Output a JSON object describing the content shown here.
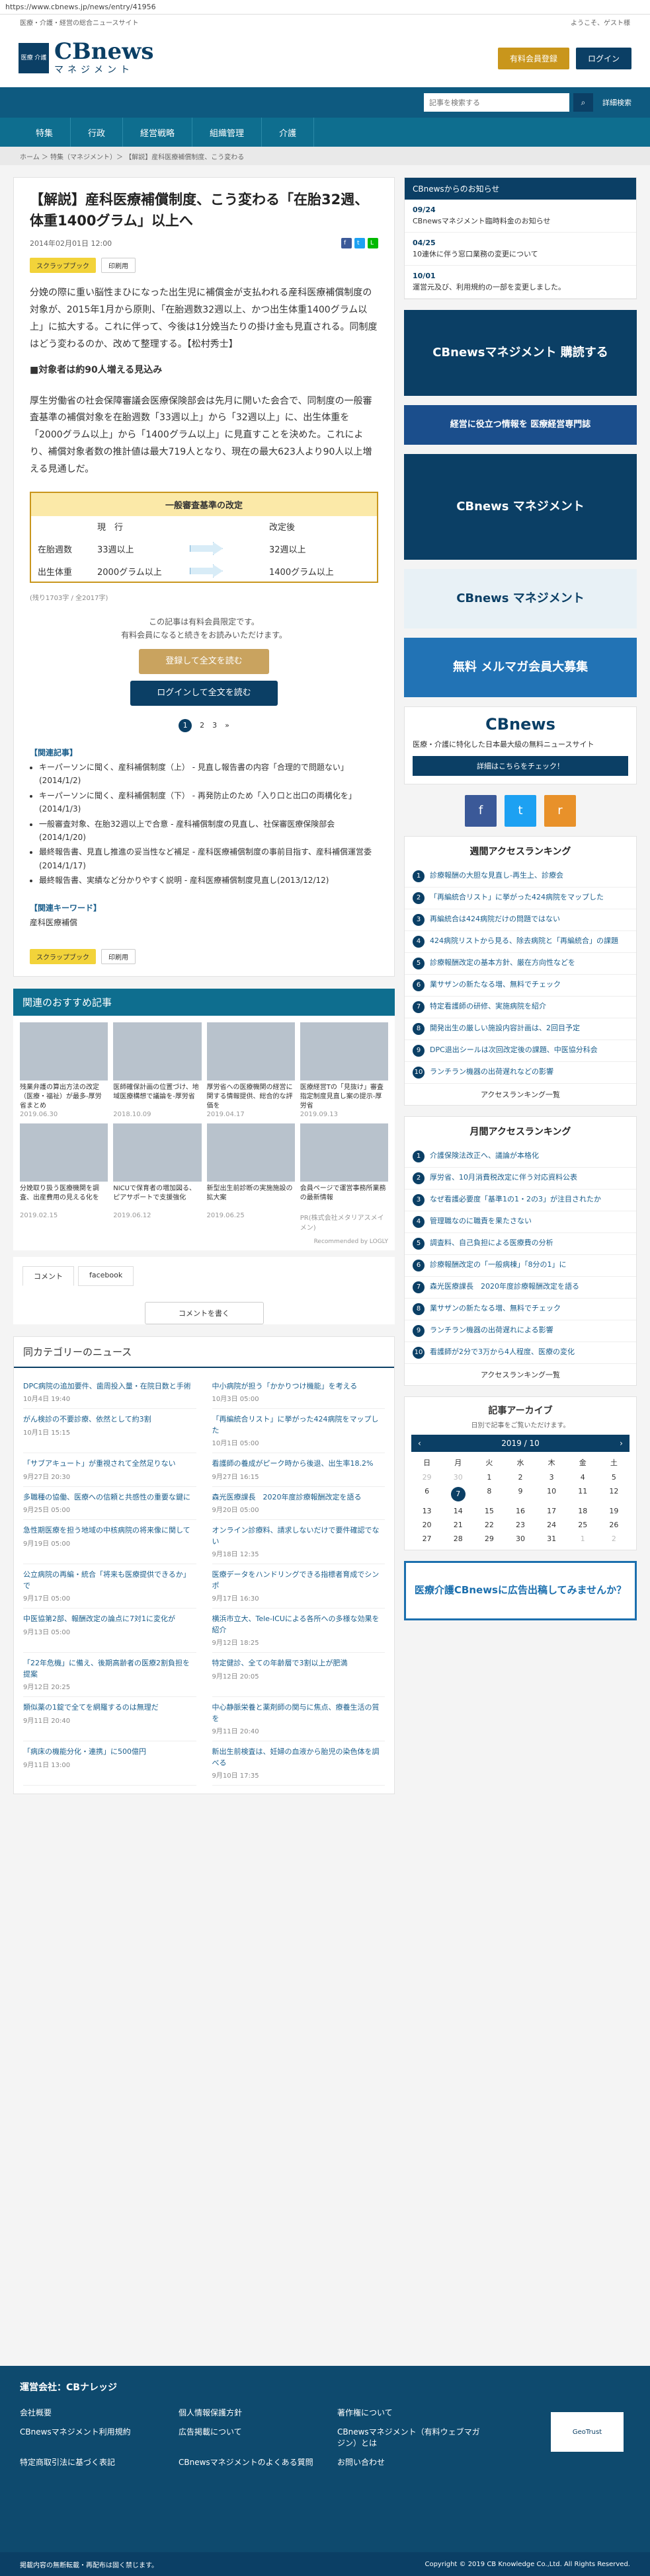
{
  "url": "https://www.cbnews.jp/news/entry/41956",
  "topstrip": {
    "left": "医療・介護・経営の総合ニュースサイト",
    "right": "ようこそ、ゲスト様"
  },
  "logo": {
    "box": "医療\n介護",
    "main": "CBnews",
    "sub": "マネジメント"
  },
  "header": {
    "member_btn": "有料会員登録",
    "login_btn": "ログイン"
  },
  "search": {
    "placeholder": "記事を検索する",
    "advanced": "詳細検索"
  },
  "nav": [
    "行政",
    "経営戦略",
    "組織管理",
    "介護",
    "特集"
  ],
  "breadcrumb": "ホーム ＞ 特集（マネジメント）＞ 【解説】産科医療補償制度、こう変わる",
  "article": {
    "title": "【解説】産科医療補償制度、こう変わる「在胎32週、体重1400グラム」以上へ",
    "date": "2014年02月01日 12:00",
    "scrap": "スクラップブック",
    "print": "印刷用",
    "lead": "分娩の際に重い脳性まひになった出生児に補償金が支払われる産科医療補償制度の対象が、2015年1月から原則、「在胎週数32週以上、かつ出生体重1400グラム以上」に拡大する。これに伴って、今後は1分娩当たりの掛け金も見直される。同制度はどう変わるのか、改めて整理する。【松村秀士】",
    "h2": "■対象者は約90人増える見込み",
    "body": "厚生労働省の社会保障審議会医療保険部会は先月に開いた会合で、同制度の一般審査基準の補償対象を在胎週数「33週以上」から「32週以上」に、出生体重を「2000グラム以上」から「1400グラム以上」に見直すことを決めた。これにより、補償対象者数の推計値は最大719人となり、現在の最大623人より90人以上増える見通しだ。",
    "table": {
      "title": "一般審査基準の改定",
      "col1": "現　行",
      "col2": "改定後",
      "rows": [
        {
          "label": "在胎週数",
          "cur": "33週以上",
          "new": "32週以上"
        },
        {
          "label": "出生体重",
          "cur": "2000グラム以上",
          "new": "1400グラム以上"
        }
      ]
    },
    "remain": "(残り1703字 / 全2017字)",
    "paywall": {
      "line1": "この記事は有料会員限定です。",
      "line2": "有料会員になると続きをお読みいただけます。",
      "btn1": "登録して全文を読む",
      "btn2": "ログインして全文を読む"
    },
    "pager": [
      "1",
      "2",
      "3",
      "»"
    ],
    "related_title": "【関連記事】",
    "related": [
      "キーパーソンに聞く、産科補償制度（上） - 見直し報告書の内容「合理的で問題ない」(2014/1/2)",
      "キーパーソンに聞く、産科補償制度（下） - 再発防止のため「入り口と出口の両構化を」(2014/1/3)",
      "一般審査対象、在胎32週以上で合意 - 産科補償制度の見直し、社保審医療保険部会(2014/1/20)",
      "最終報告書、見直し推進の妥当性など補足 - 産科医療補償制度の事前目指す、産科補償運営委(2014/1/17)",
      "最終報告書、実績など分かりやすく説明 - 産科医療補償制度見直し(2013/12/12)"
    ],
    "keyword_title": "【関連キーワード】",
    "keyword": "産科医療補償"
  },
  "recommend": {
    "title": "関連のおすすめ記事",
    "items": [
      {
        "t": "残業弁護の算出方法の改定（医療・福祉）が最多-厚労省まとめ",
        "d": "2019.06.30"
      },
      {
        "t": "医師確保計画の位置づけ、地域医療構想で議論を-厚労省",
        "d": "2018.10.09"
      },
      {
        "t": "厚労省への医療機関の経営に関する情報提供、総合的な評価を",
        "d": "2019.04.17"
      },
      {
        "t": "医療経営Tの「見抜け」審査指定制度見直し案の提示-厚労省",
        "d": "2019.09.13"
      },
      {
        "t": "分娩取り扱う医療機関を調査、出産費用の見える化を",
        "d": "2019.02.15"
      },
      {
        "t": "NICUで保育者の増加図る、ピアサポートで支援強化",
        "d": "2019.06.12"
      },
      {
        "t": "新型出生前診断の実施施設の拡大案",
        "d": "2019.06.25"
      },
      {
        "t": "会員ページで運営事務所業務の最新情報",
        "d": "PR(株式会社メタリアスメイメン)"
      }
    ],
    "by": "Recommended by LOGLY"
  },
  "comment": {
    "tab1": "コメント",
    "tab2": "facebook",
    "btn": "コメントを書く"
  },
  "same_cat": {
    "title": "同カテゴリーのニュース",
    "items": [
      {
        "t": "DPC病院の追加要件、歯周投入量・在院日数と手術",
        "d": "10月4日 19:40"
      },
      {
        "t": "中小病院が担う「かかりつけ機能」を考える",
        "d": "10月3日 05:00"
      },
      {
        "t": "がん検診の不要診療、依然として約3割",
        "d": "10月1日 15:15"
      },
      {
        "t": "「再編統合リスト」に挙がった424病院をマップした",
        "d": "10月1日 05:00"
      },
      {
        "t": "「サブアキュート」が重視されて全然足りない",
        "d": "9月27日 20:30"
      },
      {
        "t": "看護師の養成がピーク時から後退、出生率18.2%",
        "d": "9月27日 16:15"
      },
      {
        "t": "多職種の協働、医療への信頼と共感性の重要な鍵に",
        "d": "9月25日 05:00"
      },
      {
        "t": "森光医療課長　2020年度診療報酬改定を語る",
        "d": "9月20日 05:00"
      },
      {
        "t": "急性期医療を担う地域の中核病院の将来像に関して",
        "d": "9月19日 05:00"
      },
      {
        "t": "オンライン診療料、請求しないだけで要件確認でない",
        "d": "9月18日 12:35"
      },
      {
        "t": "公立病院の再編・統合「将来も医療提供できるか」で",
        "d": "9月17日 05:00"
      },
      {
        "t": "医療データをハンドリングできる指標者育成でシンポ",
        "d": "9月17日 16:30"
      },
      {
        "t": "中医協第2部、報酬改定の論点に7対1に変化が",
        "d": "9月13日 05:00"
      },
      {
        "t": "横浜市立大、Tele-ICUによる各所への多様な効果を紹介",
        "d": "9月12日 18:25"
      },
      {
        "t": "「22年危機」に備え、後期高齢者の医療2割負担を提案",
        "d": "9月12日 20:25"
      },
      {
        "t": "特定健診、全ての年齢層で3割以上が肥満",
        "d": "9月12日 20:05"
      },
      {
        "t": "類似薬の1錠で全てを網羅するのは無理だ",
        "d": "9月11日 20:40"
      },
      {
        "t": "中心静脈栄養と薬剤師の関与に焦点、療養生活の質を",
        "d": "9月11日 20:40"
      },
      {
        "t": "「病床の機能分化・連携」に500億円",
        "d": "9月11日 13:00"
      },
      {
        "t": "新出生前検査は、妊婦の血液から胎児の染色体を調べる",
        "d": "9月10日 17:35"
      }
    ]
  },
  "side": {
    "notice_title": "CBnewsからのお知らせ",
    "notices": [
      {
        "dt": "09/24",
        "t": "CBnewsマネジメント臨時料金のお知らせ"
      },
      {
        "dt": "04/25",
        "t": "10連休に伴う窓口業務の変更について"
      },
      {
        "dt": "10/01",
        "t": "運営元及び、利用規約の一部を変更しました。"
      }
    ],
    "banner1": "CBnewsマネジメント 購読する",
    "banner2": "経営に役立つ情報を 医療経営専門誌",
    "banner3": "CBnews マネジメント",
    "banner4": "無料 メルマガ会員大募集",
    "social_fb": "f",
    "social_tw": "t",
    "social_rss": "r",
    "cb_box": "医療・介護に特化した日本最大級の無料ニュースサイト",
    "cb_btn": "詳細はこちらをチェック！",
    "weekly_title": "週間アクセスランキング",
    "weekly": [
      "診療報酬の大胆な見直し-再生上、診療会",
      "「再編統合リスト」に挙がった424病院をマップした",
      "再編統合は424病院だけの問題ではない",
      "424病院リストから見る、除去病院と「再編統合」の課題",
      "診療報酬改定の基本方針、厳在方向性などを",
      "業サザンの新たなる増、無料でチェック",
      "特定看護師の研修、実施病院を紹介",
      "開発出生の厳しい施設内容計画は、2回目予定",
      "DPC退出シールは次回改定後の課題、中医協分科会",
      "ランチラン機器の出荷遅れなどの影響"
    ],
    "monthly_title": "月間アクセスランキング",
    "monthly": [
      "介護保険法改正へ、議論が本格化",
      "厚労省、10月消費税改定に伴う対応資料公表",
      "なぜ看護必要度「基準1の1・2の3」が注目されたか",
      "管理職なのに職責を果たさない",
      "調査料、自己負担による医療費の分析",
      "診療報酬改定の「一般病棟」「8分の1」に",
      "森光医療課長　2020年度診療報酬改定を語る",
      "業サザンの新たなる増、無料でチェック",
      "ランチラン機器の出荷遅れによる影響",
      "看護師が2分で3万から4人程度、医療の変化"
    ],
    "rank_more": "アクセスランキング一覧",
    "archive_title": "記事アーカイブ",
    "archive_sub": "日別で記事をご覧いただけます。",
    "cal_month": "2019 / 10",
    "cal_days": [
      "日",
      "月",
      "火",
      "水",
      "木",
      "金",
      "土"
    ],
    "cal_rows": [
      [
        "29",
        "30",
        "1",
        "2",
        "3",
        "4",
        "5"
      ],
      [
        "6",
        "7",
        "8",
        "9",
        "10",
        "11",
        "12"
      ],
      [
        "13",
        "14",
        "15",
        "16",
        "17",
        "18",
        "19"
      ],
      [
        "20",
        "21",
        "22",
        "23",
        "24",
        "25",
        "26"
      ],
      [
        "27",
        "28",
        "29",
        "30",
        "31",
        "1",
        "2"
      ]
    ],
    "ad_banner": "医療介護CBnewsに広告出稿してみませんか？"
  },
  "footer": {
    "title": "運営会社：CBナレッジ",
    "links": [
      "会社概要",
      "個人情報保護方針",
      "著作権について",
      "CBnewsマネジメント利用規約",
      "広告掲載について",
      "CBnewsマネジメント（有料ウェブマガジン）とは",
      "特定商取引法に基づく表記",
      "CBnewsマネジメントのよくある質問",
      "お問い合わせ"
    ],
    "badge": "GeoTrust",
    "copy_left": "掲載内容の無断転載・再配布は固く禁じます。",
    "copy_right": "Copyright © 2019 CB Knowledge Co.,Ltd. All Rights Reserved."
  }
}
